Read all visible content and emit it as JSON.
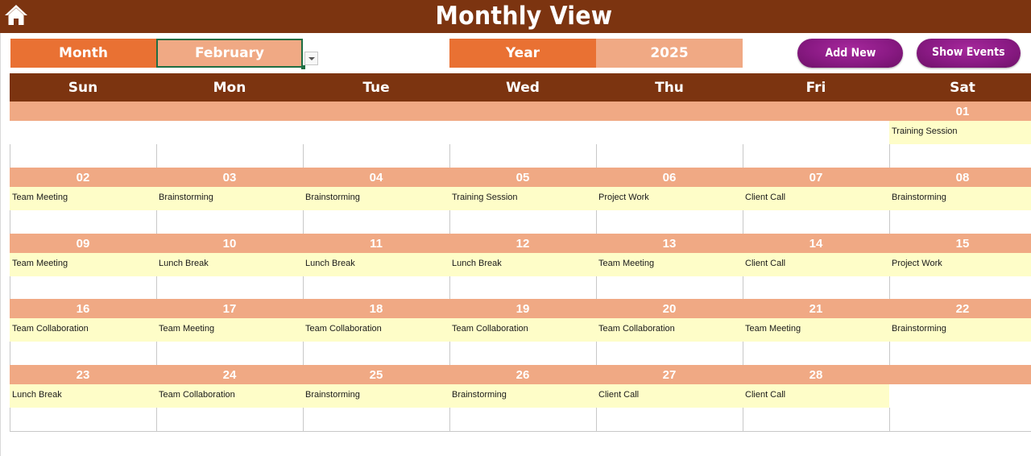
{
  "header": {
    "title": "Monthly View",
    "home_icon": "home-icon"
  },
  "controls": {
    "month_label": "Month",
    "month_value": "February",
    "year_label": "Year",
    "year_value": "2025",
    "add_new_label": "Add New",
    "show_events_label": "Show Events"
  },
  "colors": {
    "header_brown": "#7c3410",
    "label_orange": "#e97133",
    "value_salmon": "#f0a984",
    "event_yellow": "#fefdc8",
    "button_purple": "#8a1a84"
  },
  "calendar": {
    "days_of_week": [
      "Sun",
      "Mon",
      "Tue",
      "Wed",
      "Thu",
      "Fri",
      "Sat"
    ],
    "weeks": [
      [
        {
          "date": "",
          "event": ""
        },
        {
          "date": "",
          "event": ""
        },
        {
          "date": "",
          "event": ""
        },
        {
          "date": "",
          "event": ""
        },
        {
          "date": "",
          "event": ""
        },
        {
          "date": "",
          "event": ""
        },
        {
          "date": "01",
          "event": "Training Session"
        }
      ],
      [
        {
          "date": "02",
          "event": "Team Meeting"
        },
        {
          "date": "03",
          "event": "Brainstorming"
        },
        {
          "date": "04",
          "event": "Brainstorming"
        },
        {
          "date": "05",
          "event": "Training Session"
        },
        {
          "date": "06",
          "event": "Project Work"
        },
        {
          "date": "07",
          "event": "Client Call"
        },
        {
          "date": "08",
          "event": "Brainstorming"
        }
      ],
      [
        {
          "date": "09",
          "event": "Team Meeting"
        },
        {
          "date": "10",
          "event": "Lunch Break"
        },
        {
          "date": "11",
          "event": "Lunch Break"
        },
        {
          "date": "12",
          "event": "Lunch Break"
        },
        {
          "date": "13",
          "event": "Team Meeting"
        },
        {
          "date": "14",
          "event": "Client Call"
        },
        {
          "date": "15",
          "event": "Project Work"
        }
      ],
      [
        {
          "date": "16",
          "event": "Team Collaboration"
        },
        {
          "date": "17",
          "event": "Team Meeting"
        },
        {
          "date": "18",
          "event": "Team Collaboration"
        },
        {
          "date": "19",
          "event": "Team Collaboration"
        },
        {
          "date": "20",
          "event": "Team Collaboration"
        },
        {
          "date": "21",
          "event": "Team Meeting"
        },
        {
          "date": "22",
          "event": "Brainstorming"
        }
      ],
      [
        {
          "date": "23",
          "event": "Lunch Break"
        },
        {
          "date": "24",
          "event": "Team Collaboration"
        },
        {
          "date": "25",
          "event": "Brainstorming"
        },
        {
          "date": "26",
          "event": "Brainstorming"
        },
        {
          "date": "27",
          "event": "Client Call"
        },
        {
          "date": "28",
          "event": "Client Call"
        },
        {
          "date": "",
          "event": ""
        }
      ]
    ]
  }
}
